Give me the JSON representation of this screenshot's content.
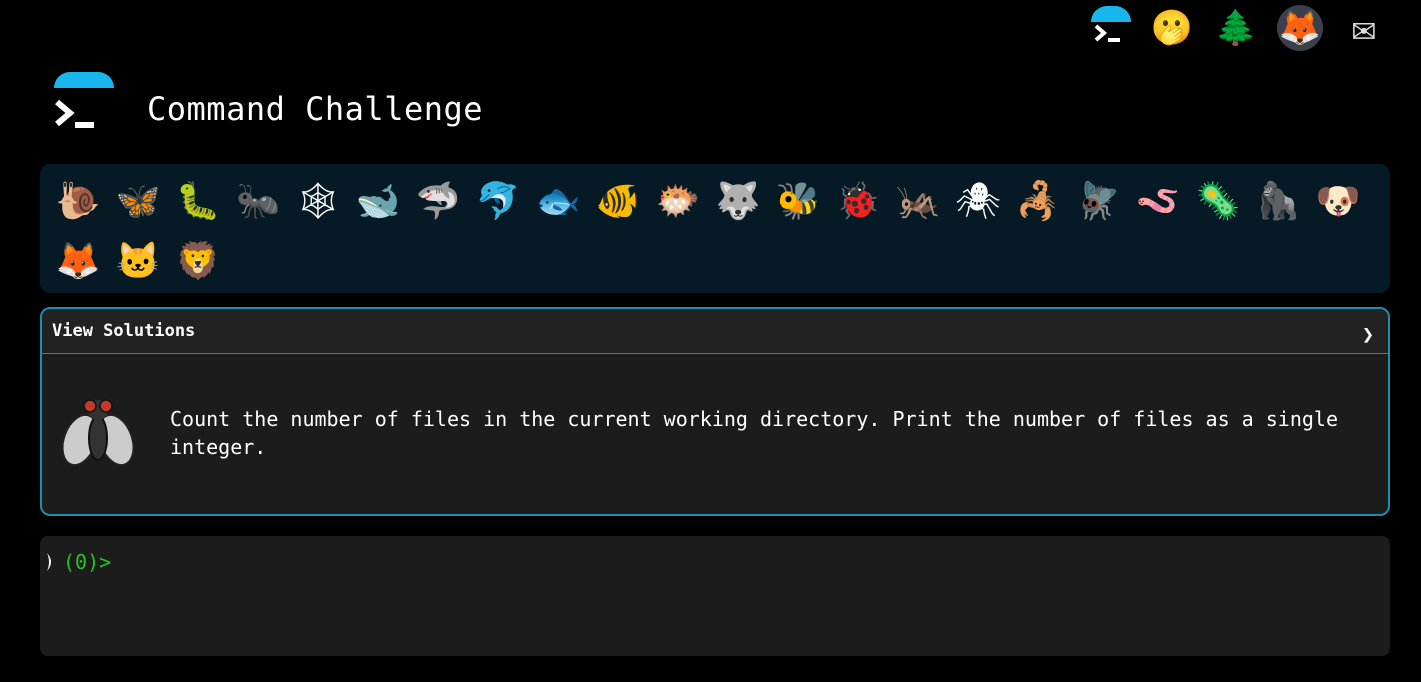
{
  "header": {
    "title": "Command Challenge"
  },
  "nav": {
    "items": [
      {
        "name": "terminal-logo-icon"
      },
      {
        "name": "hand-over-mouth-icon",
        "glyph": "🫢"
      },
      {
        "name": "tree-icon",
        "glyph": "🌲"
      },
      {
        "name": "gitlab-icon",
        "glyph": "🦊"
      },
      {
        "name": "envelope-icon",
        "glyph": "✉"
      }
    ]
  },
  "animals": [
    {
      "name": "snail",
      "glyph": "🐌"
    },
    {
      "name": "butterfly",
      "glyph": "🦋"
    },
    {
      "name": "caterpillar",
      "glyph": "🐛"
    },
    {
      "name": "ant",
      "glyph": "🐜"
    },
    {
      "name": "spider-web",
      "glyph": "🕸"
    },
    {
      "name": "whale",
      "glyph": "🐋"
    },
    {
      "name": "shark",
      "glyph": "🦈"
    },
    {
      "name": "dolphin",
      "glyph": "🐬"
    },
    {
      "name": "fish",
      "glyph": "🐟"
    },
    {
      "name": "tropical-fish",
      "glyph": "🐠"
    },
    {
      "name": "blowfish",
      "glyph": "🐡"
    },
    {
      "name": "wolf",
      "glyph": "🐺"
    },
    {
      "name": "bee",
      "glyph": "🐝"
    },
    {
      "name": "ladybug",
      "glyph": "🐞"
    },
    {
      "name": "cricket",
      "glyph": "🦗"
    },
    {
      "name": "spider",
      "glyph": "🕷"
    },
    {
      "name": "scorpion",
      "glyph": "🦂"
    },
    {
      "name": "fly",
      "glyph": "🪰"
    },
    {
      "name": "worm",
      "glyph": "🪱"
    },
    {
      "name": "microbe",
      "glyph": "🦠"
    },
    {
      "name": "gorilla",
      "glyph": "🦍"
    },
    {
      "name": "dog",
      "glyph": "🐶"
    },
    {
      "name": "fox",
      "glyph": "🦊"
    },
    {
      "name": "cat",
      "glyph": "🐱"
    },
    {
      "name": "lion",
      "glyph": "🦁"
    }
  ],
  "panel": {
    "toggle_label": "View Solutions",
    "chevron": "❯",
    "challenge_icon": "fly-icon",
    "description": "Count the number of files in the current working directory. Print the number of files as a single integer."
  },
  "terminal": {
    "prompt": "(0)>"
  },
  "colors": {
    "accent": "#19b6ee",
    "prompt": "#23c423",
    "panel_border": "#1a8fb0"
  }
}
